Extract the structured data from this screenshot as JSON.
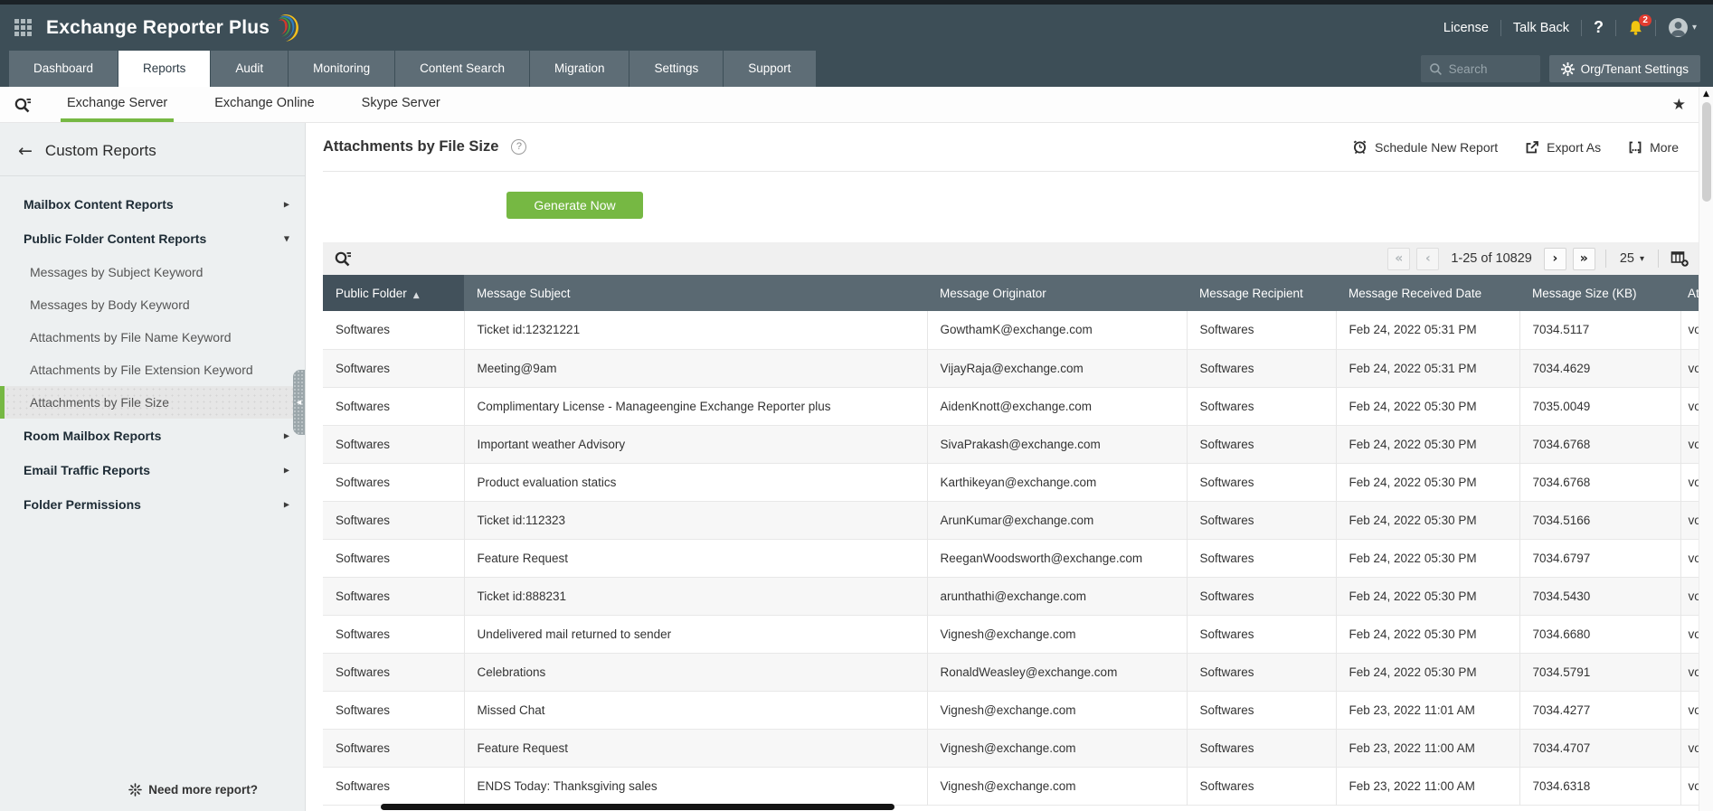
{
  "colors": {
    "accent_green": "#76b843",
    "header_slate": "#3d4e57",
    "tab_slate": "#5e6d76",
    "table_header": "#5a6972",
    "table_header_sorted": "#42515b",
    "notification_red": "#e23c30",
    "bell_yellow": "#f2c511"
  },
  "icons": {
    "back_arrow": "←",
    "star": "★",
    "caret_down": "▾",
    "caret_left": "◀",
    "caret_up": "▲",
    "chevron_right": "▶",
    "chevron_down": "▼",
    "first": "«",
    "prev": "‹",
    "next": "›",
    "last": "»",
    "help": "?",
    "question": "?"
  },
  "header": {
    "product_name": "Exchange Reporter Plus",
    "license_label": "License",
    "talkback_label": "Talk Back",
    "notification_count": "2"
  },
  "nav": {
    "tabs": [
      {
        "label": "Dashboard"
      },
      {
        "label": "Reports",
        "active": true
      },
      {
        "label": "Audit"
      },
      {
        "label": "Monitoring"
      },
      {
        "label": "Content Search"
      },
      {
        "label": "Migration"
      },
      {
        "label": "Settings"
      },
      {
        "label": "Support"
      }
    ],
    "search_placeholder": "Search",
    "org_settings_label": "Org/Tenant Settings"
  },
  "subnav": {
    "tabs": [
      {
        "label": "Exchange Server",
        "active": true
      },
      {
        "label": "Exchange Online"
      },
      {
        "label": "Skype Server"
      }
    ]
  },
  "sidebar": {
    "title": "Custom Reports",
    "items": [
      {
        "label": "Mailbox Content Reports",
        "type": "group",
        "chevron": "right"
      },
      {
        "label": "Public Folder Content Reports",
        "type": "group",
        "chevron": "down",
        "expanded": true
      },
      {
        "label": "Messages by Subject Keyword",
        "type": "sub"
      },
      {
        "label": "Messages by Body Keyword",
        "type": "sub"
      },
      {
        "label": "Attachments by File Name Keyword",
        "type": "sub"
      },
      {
        "label": "Attachments by File Extension Keyword",
        "type": "sub"
      },
      {
        "label": "Attachments by File Size",
        "type": "sub",
        "selected": true
      },
      {
        "label": "Room Mailbox Reports",
        "type": "group",
        "chevron": "right"
      },
      {
        "label": "Email Traffic Reports",
        "type": "group",
        "chevron": "right"
      },
      {
        "label": "Folder Permissions",
        "type": "group",
        "chevron": "right"
      }
    ],
    "footer_label": "Need more report?"
  },
  "main": {
    "title": "Attachments by File Size",
    "actions": {
      "schedule": "Schedule New Report",
      "export": "Export As",
      "more": "More"
    },
    "generate_button": "Generate Now",
    "pagination": {
      "range": "1-25 of 10829",
      "page_size": "25"
    },
    "table": {
      "columns": [
        {
          "label": "Public Folder",
          "sorted": true,
          "sort_glyph": "▲"
        },
        {
          "label": "Message Subject"
        },
        {
          "label": "Message Originator"
        },
        {
          "label": "Message Recipient"
        },
        {
          "label": "Message Received Date"
        },
        {
          "label": "Message Size (KB)"
        },
        {
          "label": "At"
        }
      ],
      "rows": [
        [
          "Softwares",
          "Ticket id:12321221",
          "GowthamK@exchange.com",
          "Softwares",
          "Feb 24, 2022 05:31 PM",
          "7034.5117",
          "vo"
        ],
        [
          "Softwares",
          "Meeting@9am",
          "VijayRaja@exchange.com",
          "Softwares",
          "Feb 24, 2022 05:31 PM",
          "7034.4629",
          "vo"
        ],
        [
          "Softwares",
          "Complimentary License - Manageengine Exchange Reporter plus",
          "AidenKnott@exchange.com",
          "Softwares",
          "Feb 24, 2022 05:30 PM",
          "7035.0049",
          "vo"
        ],
        [
          "Softwares",
          "Important weather Advisory",
          "SivaPrakash@exchange.com",
          "Softwares",
          "Feb 24, 2022 05:30 PM",
          "7034.6768",
          "vo"
        ],
        [
          "Softwares",
          "Product evaluation statics",
          "Karthikeyan@exchange.com",
          "Softwares",
          "Feb 24, 2022 05:30 PM",
          "7034.6768",
          "vo"
        ],
        [
          "Softwares",
          "Ticket id:112323",
          "ArunKumar@exchange.com",
          "Softwares",
          "Feb 24, 2022 05:30 PM",
          "7034.5166",
          "vo"
        ],
        [
          "Softwares",
          "Feature Request",
          "ReeganWoodsworth@exchange.com",
          "Softwares",
          "Feb 24, 2022 05:30 PM",
          "7034.6797",
          "vo"
        ],
        [
          "Softwares",
          "Ticket id:888231",
          "arunthathi@exchange.com",
          "Softwares",
          "Feb 24, 2022 05:30 PM",
          "7034.5430",
          "vo"
        ],
        [
          "Softwares",
          "Undelivered mail returned to sender",
          "Vignesh@exchange.com",
          "Softwares",
          "Feb 24, 2022 05:30 PM",
          "7034.6680",
          "vo"
        ],
        [
          "Softwares",
          "Celebrations",
          "RonaldWeasley@exchange.com",
          "Softwares",
          "Feb 24, 2022 05:30 PM",
          "7034.5791",
          "vo"
        ],
        [
          "Softwares",
          "Missed Chat",
          "Vignesh@exchange.com",
          "Softwares",
          "Feb 23, 2022 11:01 AM",
          "7034.4277",
          "vo"
        ],
        [
          "Softwares",
          "Feature Request",
          "Vignesh@exchange.com",
          "Softwares",
          "Feb 23, 2022 11:00 AM",
          "7034.4707",
          "vo"
        ],
        [
          "Softwares",
          "ENDS Today: Thanksgiving sales",
          "Vignesh@exchange.com",
          "Softwares",
          "Feb 23, 2022 11:00 AM",
          "7034.6318",
          "vo"
        ]
      ]
    }
  }
}
